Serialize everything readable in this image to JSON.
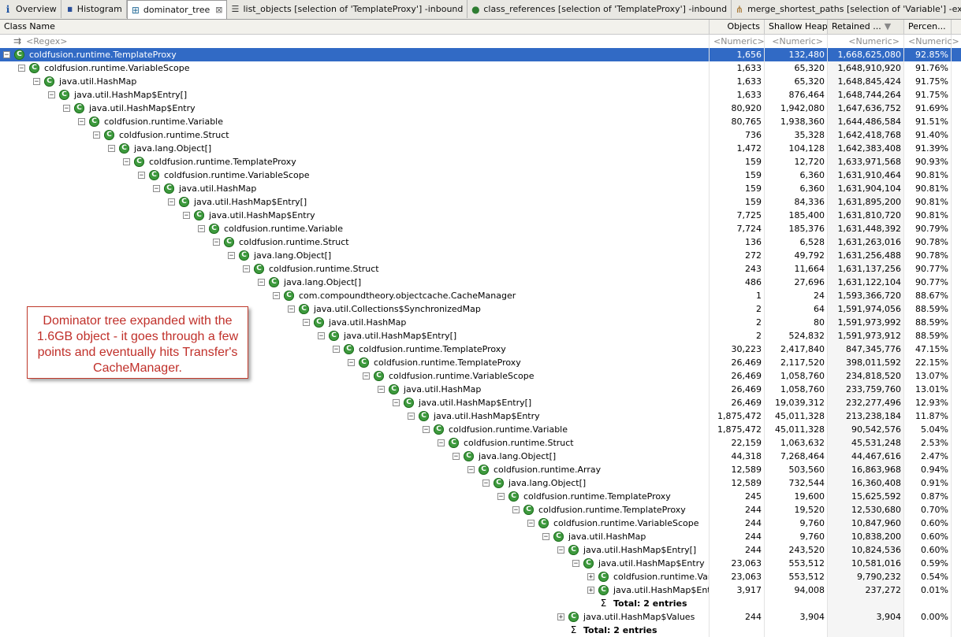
{
  "tabs": [
    {
      "label": "Overview",
      "icon": "info-icon"
    },
    {
      "label": "Histogram",
      "icon": "histogram-icon"
    },
    {
      "label": "dominator_tree",
      "icon": "tree-icon",
      "active": true
    },
    {
      "label": "list_objects [selection of 'TemplateProxy'] -inbound",
      "icon": "list-icon"
    },
    {
      "label": "class_references [selection of 'TemplateProxy'] -inbound",
      "icon": "class-references-icon"
    },
    {
      "label": "merge_shortest_paths [selection of 'Variable'] -excludes java.lang.ref....",
      "icon": "merge-paths-icon"
    }
  ],
  "columns": {
    "name": "Class Name",
    "objects": "Objects",
    "shallow": "Shallow Heap",
    "retained": "Retained ...",
    "percent": "Percen..."
  },
  "filter": {
    "name": "<Regex>",
    "objects": "<Numeric>",
    "shallow": "<Numeric>",
    "retained": "<Numeric>",
    "percent": "<Numeric>"
  },
  "rows": [
    {
      "depth": 0,
      "toggle": "−",
      "kind": "class",
      "name": "coldfusion.runtime.TemplateProxy",
      "objects": "1,656",
      "shallow": "132,480",
      "retained": "1,668,625,080",
      "percent": "92.85%",
      "selected": true
    },
    {
      "depth": 1,
      "toggle": "−",
      "kind": "class",
      "name": "coldfusion.runtime.VariableScope",
      "objects": "1,633",
      "shallow": "65,320",
      "retained": "1,648,910,920",
      "percent": "91.76%"
    },
    {
      "depth": 2,
      "toggle": "−",
      "kind": "class",
      "name": "java.util.HashMap",
      "objects": "1,633",
      "shallow": "65,320",
      "retained": "1,648,845,424",
      "percent": "91.75%"
    },
    {
      "depth": 3,
      "toggle": "−",
      "kind": "class",
      "name": "java.util.HashMap$Entry[]",
      "objects": "1,633",
      "shallow": "876,464",
      "retained": "1,648,744,264",
      "percent": "91.75%"
    },
    {
      "depth": 4,
      "toggle": "−",
      "kind": "class",
      "name": "java.util.HashMap$Entry",
      "objects": "80,920",
      "shallow": "1,942,080",
      "retained": "1,647,636,752",
      "percent": "91.69%"
    },
    {
      "depth": 5,
      "toggle": "−",
      "kind": "class",
      "name": "coldfusion.runtime.Variable",
      "objects": "80,765",
      "shallow": "1,938,360",
      "retained": "1,644,486,584",
      "percent": "91.51%"
    },
    {
      "depth": 6,
      "toggle": "−",
      "kind": "class",
      "name": "coldfusion.runtime.Struct",
      "objects": "736",
      "shallow": "35,328",
      "retained": "1,642,418,768",
      "percent": "91.40%"
    },
    {
      "depth": 7,
      "toggle": "−",
      "kind": "class",
      "name": "java.lang.Object[]",
      "objects": "1,472",
      "shallow": "104,128",
      "retained": "1,642,383,408",
      "percent": "91.39%"
    },
    {
      "depth": 8,
      "toggle": "−",
      "kind": "class",
      "name": "coldfusion.runtime.TemplateProxy",
      "objects": "159",
      "shallow": "12,720",
      "retained": "1,633,971,568",
      "percent": "90.93%"
    },
    {
      "depth": 9,
      "toggle": "−",
      "kind": "class",
      "name": "coldfusion.runtime.VariableScope",
      "objects": "159",
      "shallow": "6,360",
      "retained": "1,631,910,464",
      "percent": "90.81%"
    },
    {
      "depth": 10,
      "toggle": "−",
      "kind": "class",
      "name": "java.util.HashMap",
      "objects": "159",
      "shallow": "6,360",
      "retained": "1,631,904,104",
      "percent": "90.81%"
    },
    {
      "depth": 11,
      "toggle": "−",
      "kind": "class",
      "name": "java.util.HashMap$Entry[]",
      "objects": "159",
      "shallow": "84,336",
      "retained": "1,631,895,200",
      "percent": "90.81%"
    },
    {
      "depth": 12,
      "toggle": "−",
      "kind": "class",
      "name": "java.util.HashMap$Entry",
      "objects": "7,725",
      "shallow": "185,400",
      "retained": "1,631,810,720",
      "percent": "90.81%"
    },
    {
      "depth": 13,
      "toggle": "−",
      "kind": "class",
      "name": "coldfusion.runtime.Variable",
      "objects": "7,724",
      "shallow": "185,376",
      "retained": "1,631,448,392",
      "percent": "90.79%"
    },
    {
      "depth": 14,
      "toggle": "−",
      "kind": "class",
      "name": "coldfusion.runtime.Struct",
      "objects": "136",
      "shallow": "6,528",
      "retained": "1,631,263,016",
      "percent": "90.78%"
    },
    {
      "depth": 15,
      "toggle": "−",
      "kind": "class",
      "name": "java.lang.Object[]",
      "objects": "272",
      "shallow": "49,792",
      "retained": "1,631,256,488",
      "percent": "90.78%"
    },
    {
      "depth": 16,
      "toggle": "−",
      "kind": "class",
      "name": "coldfusion.runtime.Struct",
      "objects": "243",
      "shallow": "11,664",
      "retained": "1,631,137,256",
      "percent": "90.77%"
    },
    {
      "depth": 17,
      "toggle": "−",
      "kind": "class",
      "name": "java.lang.Object[]",
      "objects": "486",
      "shallow": "27,696",
      "retained": "1,631,122,104",
      "percent": "90.77%"
    },
    {
      "depth": 18,
      "toggle": "−",
      "kind": "class",
      "name": "com.compoundtheory.objectcache.CacheManager",
      "objects": "1",
      "shallow": "24",
      "retained": "1,593,366,720",
      "percent": "88.67%"
    },
    {
      "depth": 19,
      "toggle": "−",
      "kind": "class",
      "name": "java.util.Collections$SynchronizedMap",
      "objects": "2",
      "shallow": "64",
      "retained": "1,591,974,056",
      "percent": "88.59%"
    },
    {
      "depth": 20,
      "toggle": "−",
      "kind": "class",
      "name": "java.util.HashMap",
      "objects": "2",
      "shallow": "80",
      "retained": "1,591,973,992",
      "percent": "88.59%"
    },
    {
      "depth": 21,
      "toggle": "−",
      "kind": "class",
      "name": "java.util.HashMap$Entry[]",
      "objects": "2",
      "shallow": "524,832",
      "retained": "1,591,973,912",
      "percent": "88.59%"
    },
    {
      "depth": 22,
      "toggle": "−",
      "kind": "class",
      "name": "coldfusion.runtime.TemplateProxy",
      "objects": "30,223",
      "shallow": "2,417,840",
      "retained": "847,345,776",
      "percent": "47.15%"
    },
    {
      "depth": 23,
      "toggle": "−",
      "kind": "class",
      "name": "coldfusion.runtime.TemplateProxy",
      "objects": "26,469",
      "shallow": "2,117,520",
      "retained": "398,011,592",
      "percent": "22.15%"
    },
    {
      "depth": 24,
      "toggle": "−",
      "kind": "class",
      "name": "coldfusion.runtime.VariableScope",
      "objects": "26,469",
      "shallow": "1,058,760",
      "retained": "234,818,520",
      "percent": "13.07%"
    },
    {
      "depth": 25,
      "toggle": "−",
      "kind": "class",
      "name": "java.util.HashMap",
      "objects": "26,469",
      "shallow": "1,058,760",
      "retained": "233,759,760",
      "percent": "13.01%"
    },
    {
      "depth": 26,
      "toggle": "−",
      "kind": "class",
      "name": "java.util.HashMap$Entry[]",
      "objects": "26,469",
      "shallow": "19,039,312",
      "retained": "232,277,496",
      "percent": "12.93%"
    },
    {
      "depth": 27,
      "toggle": "−",
      "kind": "class",
      "name": "java.util.HashMap$Entry",
      "objects": "1,875,472",
      "shallow": "45,011,328",
      "retained": "213,238,184",
      "percent": "11.87%"
    },
    {
      "depth": 28,
      "toggle": "−",
      "kind": "class",
      "name": "coldfusion.runtime.Variable",
      "objects": "1,875,472",
      "shallow": "45,011,328",
      "retained": "90,542,576",
      "percent": "5.04%"
    },
    {
      "depth": 29,
      "toggle": "−",
      "kind": "class",
      "name": "coldfusion.runtime.Struct",
      "objects": "22,159",
      "shallow": "1,063,632",
      "retained": "45,531,248",
      "percent": "2.53%"
    },
    {
      "depth": 30,
      "toggle": "−",
      "kind": "class",
      "name": "java.lang.Object[]",
      "objects": "44,318",
      "shallow": "7,268,464",
      "retained": "44,467,616",
      "percent": "2.47%"
    },
    {
      "depth": 31,
      "toggle": "−",
      "kind": "class",
      "name": "coldfusion.runtime.Array",
      "objects": "12,589",
      "shallow": "503,560",
      "retained": "16,863,968",
      "percent": "0.94%"
    },
    {
      "depth": 32,
      "toggle": "−",
      "kind": "class",
      "name": "java.lang.Object[]",
      "objects": "12,589",
      "shallow": "732,544",
      "retained": "16,360,408",
      "percent": "0.91%"
    },
    {
      "depth": 33,
      "toggle": "−",
      "kind": "class",
      "name": "coldfusion.runtime.TemplateProxy",
      "objects": "245",
      "shallow": "19,600",
      "retained": "15,625,592",
      "percent": "0.87%"
    },
    {
      "depth": 34,
      "toggle": "−",
      "kind": "class",
      "name": "coldfusion.runtime.TemplateProxy",
      "objects": "244",
      "shallow": "19,520",
      "retained": "12,530,680",
      "percent": "0.70%"
    },
    {
      "depth": 35,
      "toggle": "−",
      "kind": "class",
      "name": "coldfusion.runtime.VariableScope",
      "objects": "244",
      "shallow": "9,760",
      "retained": "10,847,960",
      "percent": "0.60%"
    },
    {
      "depth": 36,
      "toggle": "−",
      "kind": "class",
      "name": "java.util.HashMap",
      "objects": "244",
      "shallow": "9,760",
      "retained": "10,838,200",
      "percent": "0.60%"
    },
    {
      "depth": 37,
      "toggle": "−",
      "kind": "class",
      "name": "java.util.HashMap$Entry[]",
      "objects": "244",
      "shallow": "243,520",
      "retained": "10,824,536",
      "percent": "0.60%"
    },
    {
      "depth": 38,
      "toggle": "−",
      "kind": "class",
      "name": "java.util.HashMap$Entry",
      "objects": "23,063",
      "shallow": "553,512",
      "retained": "10,581,016",
      "percent": "0.59%"
    },
    {
      "depth": 39,
      "toggle": "+",
      "kind": "class",
      "name": "coldfusion.runtime.Variable",
      "objects": "23,063",
      "shallow": "553,512",
      "retained": "9,790,232",
      "percent": "0.54%"
    },
    {
      "depth": 39,
      "toggle": "+",
      "kind": "class",
      "name": "java.util.HashMap$Entry",
      "objects": "3,917",
      "shallow": "94,008",
      "retained": "237,272",
      "percent": "0.01%"
    },
    {
      "depth": 39,
      "toggle": "",
      "kind": "total",
      "name": "Total: 2 entries",
      "objects": "",
      "shallow": "",
      "retained": "",
      "percent": ""
    },
    {
      "depth": 37,
      "toggle": "+",
      "kind": "class",
      "name": "java.util.HashMap$Values",
      "objects": "244",
      "shallow": "3,904",
      "retained": "3,904",
      "percent": "0.00%"
    },
    {
      "depth": 37,
      "toggle": "",
      "kind": "total",
      "name": "Total: 2 entries",
      "objects": "",
      "shallow": "",
      "retained": "",
      "percent": ""
    }
  ],
  "callout": "Dominator tree expanded with the 1.6GB object - it goes through a few points and eventually hits Transfer's CacheManager.",
  "colors": {
    "selection": "#316ac5",
    "class_icon": "#3d9a3d",
    "callout_text": "#c0302a"
  }
}
